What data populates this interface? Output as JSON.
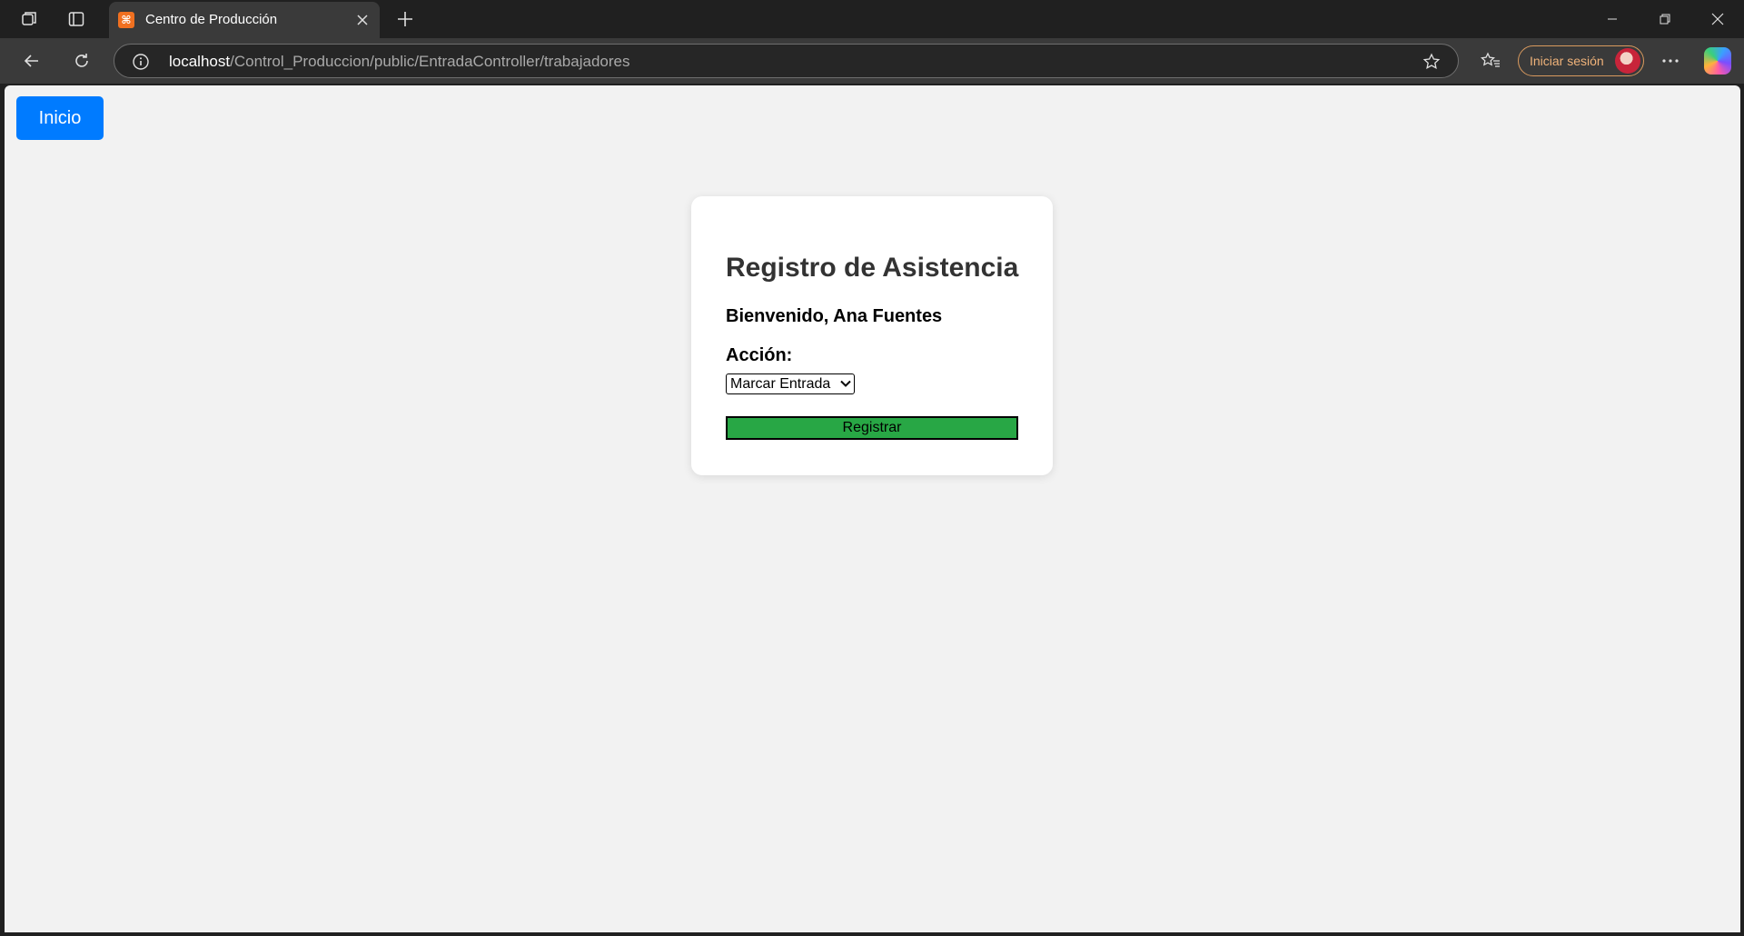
{
  "browser": {
    "tab": {
      "title": "Centro de Producción",
      "favicon": "xampp-icon"
    },
    "url": {
      "host": "localhost",
      "path": "/Control_Produccion/public/EntradaController/trabajadores"
    },
    "signin_label": "Iniciar sesión",
    "colors": {
      "frame": "#202020",
      "toolbar": "#3a3a3a",
      "signin_accent": "#f0b37a"
    }
  },
  "page": {
    "home_button": "Inicio",
    "card": {
      "title": "Registro de Asistencia",
      "welcome": "Bienvenido, Ana Fuentes",
      "action_label": "Acción:",
      "action_selected": "Marcar Entrada",
      "submit_label": "Registrar"
    },
    "colors": {
      "background": "#f2f2f2",
      "home_button": "#007bff",
      "submit_button": "#28a745"
    }
  }
}
